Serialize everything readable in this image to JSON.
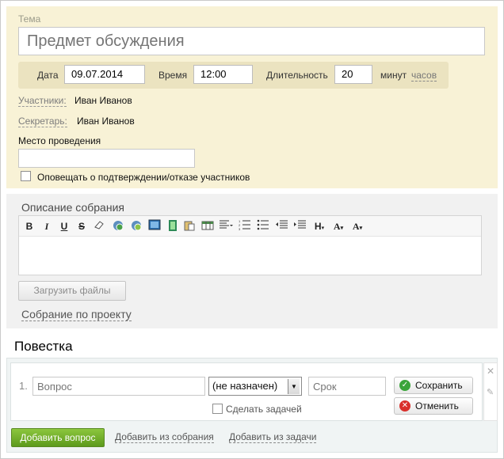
{
  "form": {
    "topic_label": "Тема",
    "topic_placeholder": "Предмет обсуждения",
    "date_label": "Дата",
    "date_value": "09.07.2014",
    "time_label": "Время",
    "time_value": "12:00",
    "duration_label": "Длительность",
    "duration_value": "20",
    "unit_minutes": "минут",
    "unit_hours": "часов",
    "participants_label": "Участники:",
    "participants_value": "Иван Иванов",
    "secretary_label": "Секретарь:",
    "secretary_value": "Иван Иванов",
    "place_label": "Место проведения",
    "place_value": "",
    "notify_label": "Оповещать о подтверждении/отказе участников"
  },
  "description": {
    "title": "Описание собрания",
    "upload_label": "Загрузить файлы",
    "project_link": "Собрание по проекту"
  },
  "toolbar": {
    "icons": [
      "bold-icon",
      "italic-icon",
      "underline-icon",
      "strikethrough-icon",
      "eraser-icon",
      "link-icon",
      "unlink-icon",
      "image-icon",
      "video-icon",
      "paste-icon",
      "table-icon",
      "align-icon",
      "ordered-list-icon",
      "unordered-list-icon",
      "outdent-icon",
      "indent-icon",
      "heading-icon",
      "font-size-icon",
      "font-color-icon"
    ]
  },
  "agenda": {
    "title": "Повестка",
    "item_number": "1.",
    "question_placeholder": "Вопрос",
    "responsible_value": "(не назначен)",
    "deadline_placeholder": "Срок",
    "make_task_label": "Сделать задачей",
    "save_label": "Сохранить",
    "cancel_label": "Отменить",
    "add_question_label": "Добавить вопрос",
    "add_from_meeting_label": "Добавить из собрания",
    "add_from_task_label": "Добавить из задачи"
  },
  "colors": {
    "top_bg": "#f8f2d6",
    "date_bar_bg": "#ebe3c0",
    "add_button": "#6fae2a",
    "save_icon": "#3aa53a",
    "cancel_icon": "#d9302b"
  }
}
